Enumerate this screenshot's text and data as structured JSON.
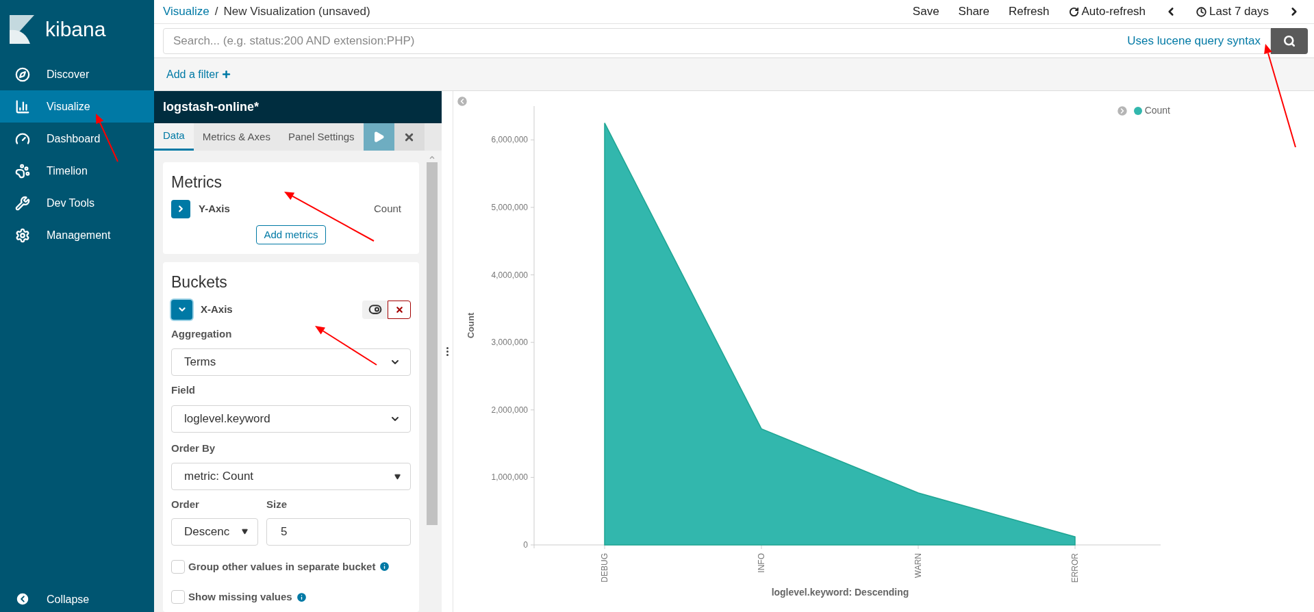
{
  "brand": "kibana",
  "sidebar": {
    "items": [
      {
        "label": "Discover",
        "selected": false
      },
      {
        "label": "Visualize",
        "selected": true
      },
      {
        "label": "Dashboard",
        "selected": false
      },
      {
        "label": "Timelion",
        "selected": false
      },
      {
        "label": "Dev Tools",
        "selected": false
      },
      {
        "label": "Management",
        "selected": false
      }
    ],
    "collapse": "Collapse"
  },
  "breadcrumb": {
    "link": "Visualize",
    "separator": "/",
    "current": "New Visualization (unsaved)"
  },
  "top_menu": [
    "Save",
    "Share",
    "Refresh",
    "Auto-refresh",
    "Last 7 days"
  ],
  "search": {
    "placeholder": "Search... (e.g. status:200 AND extension:PHP)",
    "syntax_link": "Uses lucene query syntax"
  },
  "filter_bar": {
    "add_filter": "Add a filter"
  },
  "editor": {
    "index_pattern": "logstash-online*",
    "tabs": [
      {
        "label": "Data",
        "selected": true
      },
      {
        "label": "Metrics & Axes",
        "selected": false
      },
      {
        "label": "Panel Settings",
        "selected": false
      }
    ],
    "metrics": {
      "title": "Metrics",
      "items": [
        {
          "label": "Y-Axis",
          "value": "Count",
          "expanded": false
        }
      ],
      "add_button": "Add metrics"
    },
    "buckets": {
      "title": "Buckets",
      "item": {
        "label": "X-Axis",
        "expanded": true,
        "enabled": true
      },
      "aggregation": {
        "label": "Aggregation",
        "value": "Terms"
      },
      "field": {
        "label": "Field",
        "value": "loglevel.keyword"
      },
      "order_by": {
        "label": "Order By",
        "value": "metric: Count"
      },
      "order": {
        "label": "Order",
        "value": "Descenc"
      },
      "size": {
        "label": "Size",
        "value": "5"
      },
      "options": [
        {
          "label": "Group other values in separate bucket",
          "checked": false
        },
        {
          "label": "Show missing values",
          "checked": false
        }
      ]
    }
  },
  "visualization": {
    "chart_data": {
      "type": "area",
      "xlabel": "loglevel.keyword: Descending",
      "ylabel": "Count",
      "categories": [
        "DEBUG",
        "INFO",
        "WARN",
        "ERROR"
      ],
      "series": [
        {
          "name": "Count",
          "color": "#32b7ad",
          "values": [
            6250000,
            1720000,
            770000,
            120000
          ]
        }
      ],
      "ylim": [
        0,
        6500000
      ],
      "yticks": [
        {
          "value": 0,
          "label": "0"
        },
        {
          "value": 1000000,
          "label": "1,000,000"
        },
        {
          "value": 2000000,
          "label": "2,000,000"
        },
        {
          "value": 3000000,
          "label": "3,000,000"
        },
        {
          "value": 4000000,
          "label": "4,000,000"
        },
        {
          "value": 5000000,
          "label": "5,000,000"
        },
        {
          "value": 6000000,
          "label": "6,000,000"
        }
      ]
    }
  }
}
